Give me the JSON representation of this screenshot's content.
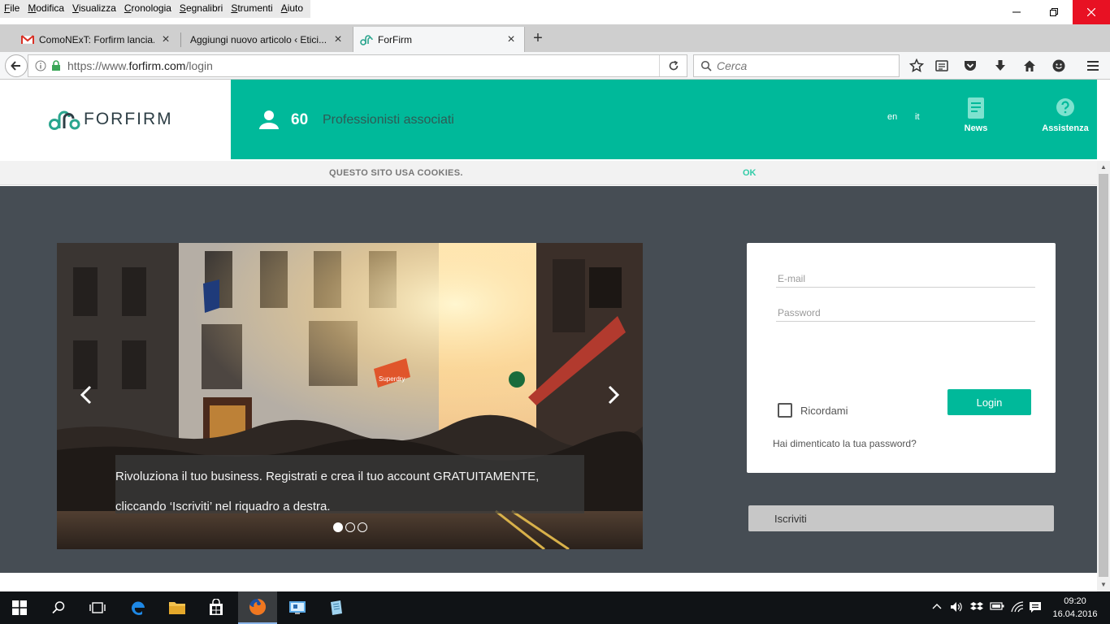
{
  "menubar": {
    "items": [
      "File",
      "Modifica",
      "Visualizza",
      "Cronologia",
      "Segnalibri",
      "Strumenti",
      "Aiuto"
    ]
  },
  "tabs": [
    {
      "title": "ComoNExT: Forfirm lancia...",
      "favicon": "gmail-icon"
    },
    {
      "title": "Aggiungi nuovo articolo ‹ Etici...",
      "favicon": "none"
    },
    {
      "title": "ForFirm",
      "favicon": "forfirm-logo-icon"
    }
  ],
  "navbar": {
    "url_prefix": "https://www.",
    "url_host": "forfirm.com",
    "url_path": "/login",
    "search_placeholder": "Cerca"
  },
  "site": {
    "logo_text": "FORFIRM",
    "pro_count": "60",
    "pro_label": "Professionisti associati",
    "lang_en": "en",
    "lang_it": "it",
    "nav_news": "News",
    "nav_help": "Assistenza",
    "cookie_text": "QUESTO SITO USA COOKIES.",
    "cookie_ok": "OK",
    "brand_color": "#00b99a"
  },
  "slider": {
    "caption_line1": "Rivoluziona il tuo business. Registrati e crea il tuo account GRATUITAMENTE,",
    "caption_line2": "cliccando ‘Iscriviti’ nel riquadro a destra.",
    "shop_sign": "Superdry",
    "dots": 3,
    "active_dot": 1
  },
  "login": {
    "email_placeholder": "E-mail",
    "password_placeholder": "Password",
    "remember_label": "Ricordami",
    "login_label": "Login",
    "forgot_label": "Hai dimenticato la tua password?",
    "signup_label": "Iscriviti"
  },
  "taskbar": {
    "time": "09:20",
    "date": "16.04.2016"
  }
}
